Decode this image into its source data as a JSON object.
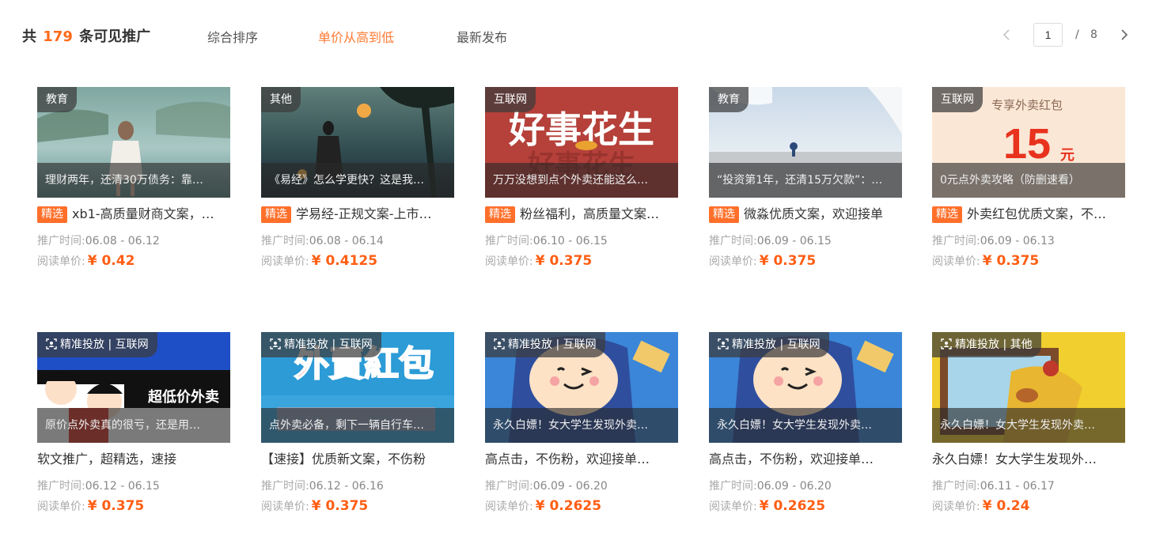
{
  "header": {
    "total_prefix": "共",
    "total_count": "179",
    "total_suffix": "条可见推广",
    "sort_options": [
      {
        "label": "综合排序",
        "active": false
      },
      {
        "label": "单价从高到低",
        "active": true
      },
      {
        "label": "最新发布",
        "active": false
      }
    ]
  },
  "pagination": {
    "current_page": "1",
    "separator": "/",
    "total_pages": "8"
  },
  "colors": {
    "accent": "#ff6f2a",
    "price": "#ff5e14",
    "active_sort": "#ff7a33"
  },
  "labels": {
    "time_label": "推广时间:",
    "price_label": "阅读单价:",
    "featured_badge": "精选",
    "targeting_icon": "target-icon"
  },
  "cards": [
    {
      "category": "教育",
      "targeted": false,
      "featured": true,
      "overlay": "理财两年，还清30万债务：靠…",
      "title": "xb1-高质量财商文案，…",
      "time": "06.08 - 06.12",
      "price": "¥ 0.42"
    },
    {
      "category": "其他",
      "targeted": false,
      "featured": true,
      "overlay": "《易经》怎么学更快？这是我…",
      "title": "学易经-正规文案-上市…",
      "time": "06.08 - 06.14",
      "price": "¥ 0.4125"
    },
    {
      "category": "互联网",
      "targeted": false,
      "featured": true,
      "overlay": "万万没想到点个外卖还能这么…",
      "title": "粉丝福利，高质量文案…",
      "time": "06.10 - 06.15",
      "price": "¥ 0.375",
      "thumb_text": "好事花生"
    },
    {
      "category": "教育",
      "targeted": false,
      "featured": true,
      "overlay": "“投资第1年，还清15万欠款”：…",
      "title": "微淼优质文案，欢迎接单",
      "time": "06.09 - 06.15",
      "price": "¥ 0.375"
    },
    {
      "category": "互联网",
      "targeted": false,
      "featured": true,
      "overlay": "0元点外卖攻略（防删速看）",
      "title": "外卖红包优质文案，不…",
      "time": "06.09 - 06.13",
      "price": "¥ 0.375",
      "thumb_text": "专享外卖红包",
      "thumb_amount": "15",
      "thumb_unit": "元"
    },
    {
      "category": "精准投放 | 互联网",
      "targeted": true,
      "featured": false,
      "overlay": "原价点外卖真的很亏，还是用…",
      "title": "软文推广，超精选，速接",
      "time": "06.12 - 06.15",
      "price": "¥ 0.375",
      "thumb_text": "超低价外卖"
    },
    {
      "category": "精准投放 | 互联网",
      "targeted": true,
      "featured": false,
      "overlay": "点外卖必备，剩下一辆自行车…",
      "title": "【速接】优质新文案，不伤粉",
      "time": "06.12 - 06.16",
      "price": "¥ 0.375",
      "thumb_text": "外賣紅包"
    },
    {
      "category": "精准投放 | 互联网",
      "targeted": true,
      "featured": false,
      "overlay": "永久白嫖！女大学生发现外卖…",
      "title": "高点击，不伤粉，欢迎接单…",
      "time": "06.09 - 06.20",
      "price": "¥ 0.2625"
    },
    {
      "category": "精准投放 | 互联网",
      "targeted": true,
      "featured": false,
      "overlay": "永久白嫖！女大学生发现外卖…",
      "title": "高点击，不伤粉，欢迎接单…",
      "time": "06.09 - 06.20",
      "price": "¥ 0.2625"
    },
    {
      "category": "精准投放 | 其他",
      "targeted": true,
      "featured": false,
      "overlay": "永久白嫖！女大学生发现外卖…",
      "title": "永久白嫖！女大学生发现外…",
      "time": "06.11 - 06.17",
      "price": "¥ 0.24"
    }
  ]
}
